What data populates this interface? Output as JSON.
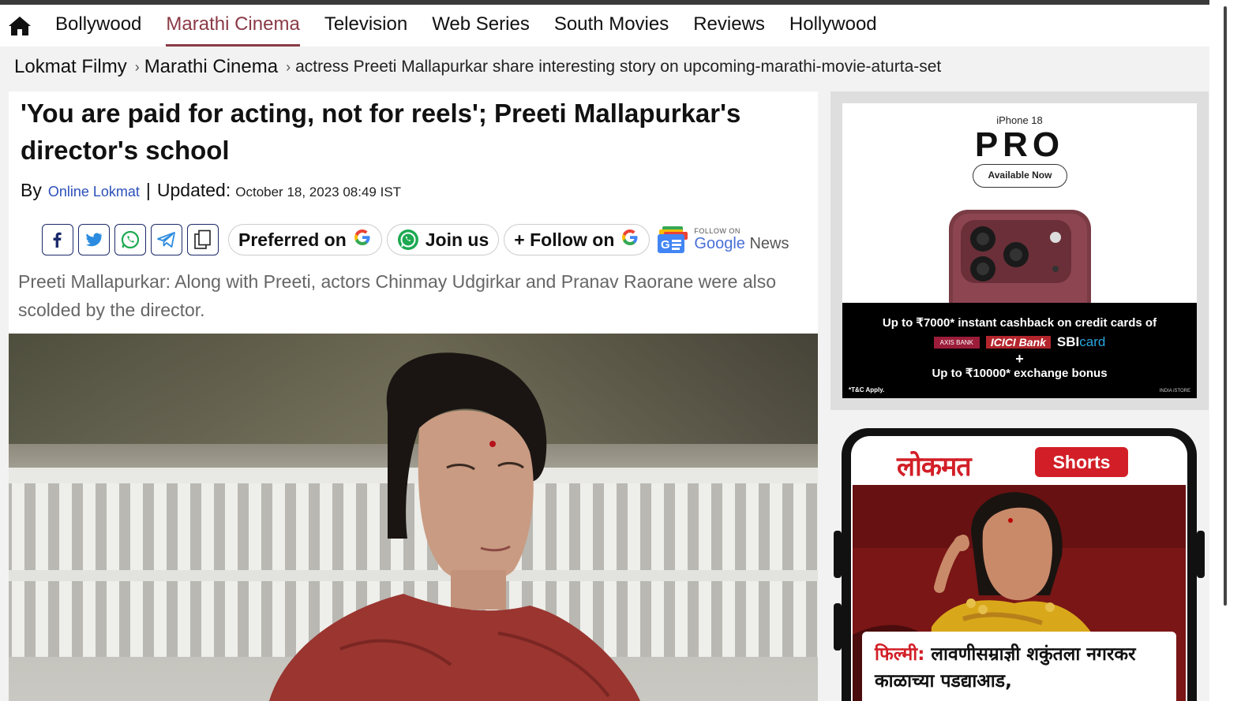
{
  "nav": {
    "items": [
      {
        "label": "Bollywood",
        "active": false
      },
      {
        "label": "Marathi Cinema",
        "active": true
      },
      {
        "label": "Television",
        "active": false
      },
      {
        "label": "Web Series",
        "active": false
      },
      {
        "label": "South Movies",
        "active": false
      },
      {
        "label": "Reviews",
        "active": false
      },
      {
        "label": "Hollywood",
        "active": false
      }
    ],
    "accent": "#8a3a46"
  },
  "breadcrumb": {
    "home": "Lokmat Filmy",
    "section": "Marathi Cinema",
    "current": "actress Preeti Mallapurkar share interesting story on upcoming-marathi-movie-aturta-set"
  },
  "article": {
    "headline": "'You are paid for acting, not for reels'; Preeti Mallapurkar's director's school",
    "by_label": "By",
    "author": "Online Lokmat",
    "separator": "|",
    "updated_label": "Updated:",
    "date": "October 18, 2023 08:49 IST",
    "summary": "Preeti Mallapurkar: Along with Preeti, actors Chinmay Udgirkar and Pranav Raorane were also scolded by the director."
  },
  "share": {
    "icons": [
      "facebook-icon",
      "twitter-icon",
      "whatsapp-icon",
      "telegram-icon",
      "copy-icon"
    ],
    "preferred_label": "Preferred on",
    "join_label": "Join us",
    "follow_label": "+ Follow on",
    "gnews_follow": "FOLLOW ON",
    "gnews_google": "Google",
    "gnews_news": " News"
  },
  "ad": {
    "brand": "iPhone 18",
    "model": "PRO",
    "cta": "Available Now",
    "offer1": "Up to ₹7000* instant cashback on credit cards of",
    "bank1": "AXIS BANK",
    "bank2": "ICICI Bank",
    "bank3a": "SBI",
    "bank3b": "card",
    "plus": "+",
    "offer2": "Up to ₹10000* exchange bonus",
    "tc": "*T&C Apply.",
    "store": "INDIA iSTORE"
  },
  "shorts": {
    "logo": "लोकमत",
    "badge": "Shorts",
    "tag": "फिल्मी:",
    "headline": " लावणीसम्राज्ञी शकुंतला नगरकर काळाच्या पडद्याआड,"
  },
  "colors": {
    "link": "#2a4fb8",
    "lokmat_red": "#d21f27"
  }
}
